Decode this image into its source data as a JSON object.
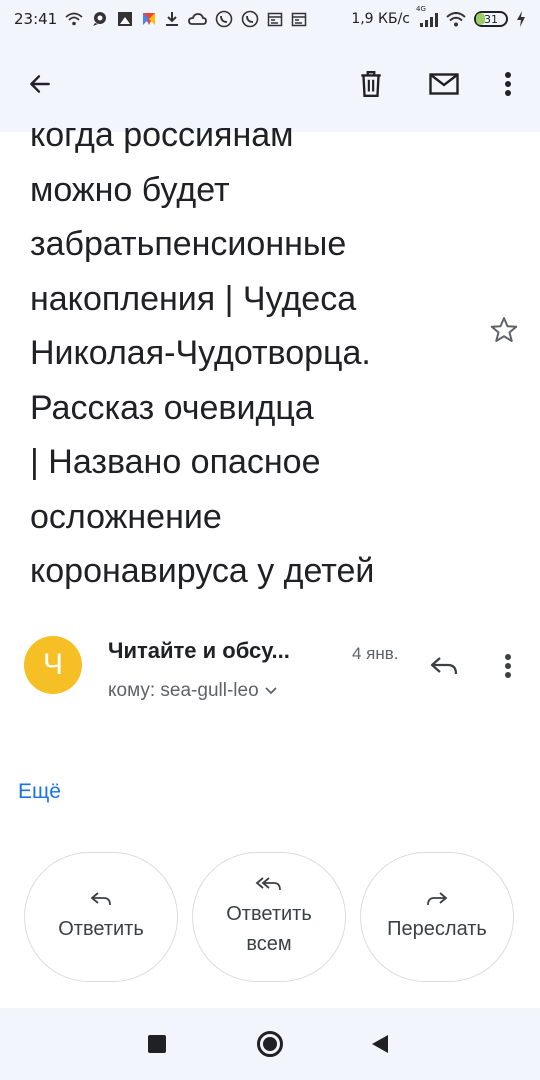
{
  "status_bar": {
    "time": "23:41",
    "speed": "1,9 КБ/с",
    "network_badge": "4G",
    "battery_level": "31",
    "battery_fraction": 0.31,
    "icons": [
      "wifi-signal-icon",
      "chat-bubble-icon",
      "photo-app-icon",
      "download-icon",
      "cloud-icon",
      "viber-icon",
      "viber-icon",
      "calendar-icon",
      "calendar-icon",
      "cell-signal-icon",
      "wifi-icon",
      "battery-icon",
      "charging-icon"
    ]
  },
  "app_bar": {
    "icons": [
      "back-arrow-icon",
      "trash-icon",
      "mail-icon",
      "more-vert-icon"
    ]
  },
  "email_body": {
    "lines": [
      "когда россиянам",
      "можно будет",
      "забратьпенсионные",
      "накопления | Чудеса",
      "Николая-Чудотворца.",
      "Рассказ очевидца",
      "| Названо опасное",
      "осложнение",
      "коронавируса у детей"
    ],
    "star_icon": "star-outline-icon"
  },
  "sender": {
    "avatar_letter": "Ч",
    "avatar_color": "#f6bf26",
    "name": "Читайте и обсу...",
    "date": "4 янв.",
    "recipient": "кому: sea-gull-leo"
  },
  "more_link": "Ещё",
  "actions": {
    "reply": "Ответить",
    "reply_all": "Ответить всем",
    "forward": "Переслать"
  },
  "colors": {
    "accent": "#1a73e8",
    "bar_background": "#f2f6fc",
    "avatar": "#f6bf26"
  },
  "nav_bar": {
    "icons": [
      "recents-square-icon",
      "home-circle-icon",
      "back-triangle-icon"
    ]
  }
}
